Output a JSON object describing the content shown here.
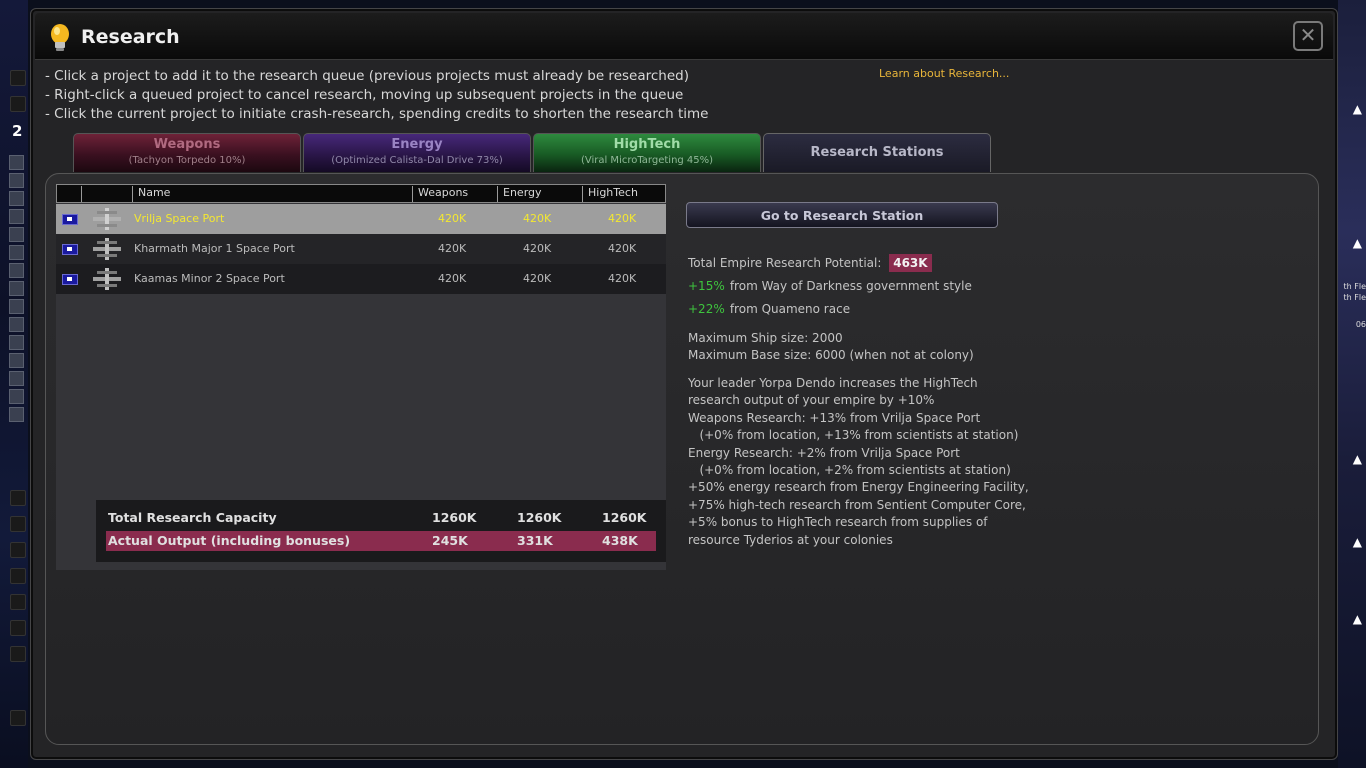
{
  "window": {
    "title": "Research",
    "close_glyph": "✕",
    "learn_link": "Learn about Research..."
  },
  "instructions": [
    "- Click a project to add it to the research queue (previous projects must already be researched)",
    "- Right-click a queued project to cancel research, moving up subsequent projects in the queue",
    "- Click the current project to initiate crash-research, spending credits to shorten the research time"
  ],
  "tabs": [
    {
      "label": "Weapons",
      "sub": "(Tachyon Torpedo 10%)"
    },
    {
      "label": "Energy",
      "sub": "(Optimized Calista-Dal Drive 73%)"
    },
    {
      "label": "HighTech",
      "sub": "(Viral MicroTargeting 45%)"
    },
    {
      "label": "Research Stations"
    }
  ],
  "table": {
    "headers": {
      "name": "Name",
      "weapons": "Weapons",
      "energy": "Energy",
      "hightech": "HighTech"
    },
    "rows": [
      {
        "name": "Vrilja Space Port",
        "weapons": "420K",
        "energy": "420K",
        "hightech": "420K"
      },
      {
        "name": "Kharmath Major 1 Space Port",
        "weapons": "420K",
        "energy": "420K",
        "hightech": "420K"
      },
      {
        "name": "Kaamas Minor 2 Space Port",
        "weapons": "420K",
        "energy": "420K",
        "hightech": "420K"
      }
    ],
    "totals": [
      {
        "label": "Total Research Capacity",
        "weapons": "1260K",
        "energy": "1260K",
        "hightech": "1260K"
      },
      {
        "label": "Actual Output (including bonuses)",
        "weapons": "245K",
        "energy": "331K",
        "hightech": "438K"
      }
    ]
  },
  "side": {
    "goto_button": "Go to Research Station",
    "potential_label": "Total Empire Research Potential:",
    "potential_value": "463K",
    "bonuses": [
      {
        "pct": "+15%",
        "text": "from Way of Darkness government style"
      },
      {
        "pct": "+22%",
        "text": "from Quameno race"
      }
    ],
    "max_ship": "Maximum Ship size: 2000",
    "max_base": "Maximum Base size: 6000 (when not at colony)",
    "details": [
      "Your leader Yorpa Dendo increases the HighTech",
      "research output of your empire by +10%",
      "Weapons Research: +13% from Vrilja Space Port",
      "   (+0% from location, +13% from scientists at station)",
      "Energy Research: +2% from Vrilja Space Port",
      "   (+0% from location, +2% from scientists at station)",
      "+50% energy research from Energy Engineering Facility,",
      "+75% high-tech research from Sentient Computer Core,",
      "+5% bonus to HighTech research from supplies of",
      "resource Tyderios at your colonies"
    ]
  },
  "background": {
    "left_number": "2",
    "right_labels": [
      "th Fle",
      "th Fle",
      "06"
    ]
  },
  "colors": {
    "weapons": "#6e2238",
    "energy": "#47287a",
    "hightech": "#2e8a3e",
    "selected_row_text": "#f4e830",
    "accent_badge": "#8a2c4e",
    "bonus_green": "#3ec43e",
    "link": "#e8b53a"
  }
}
